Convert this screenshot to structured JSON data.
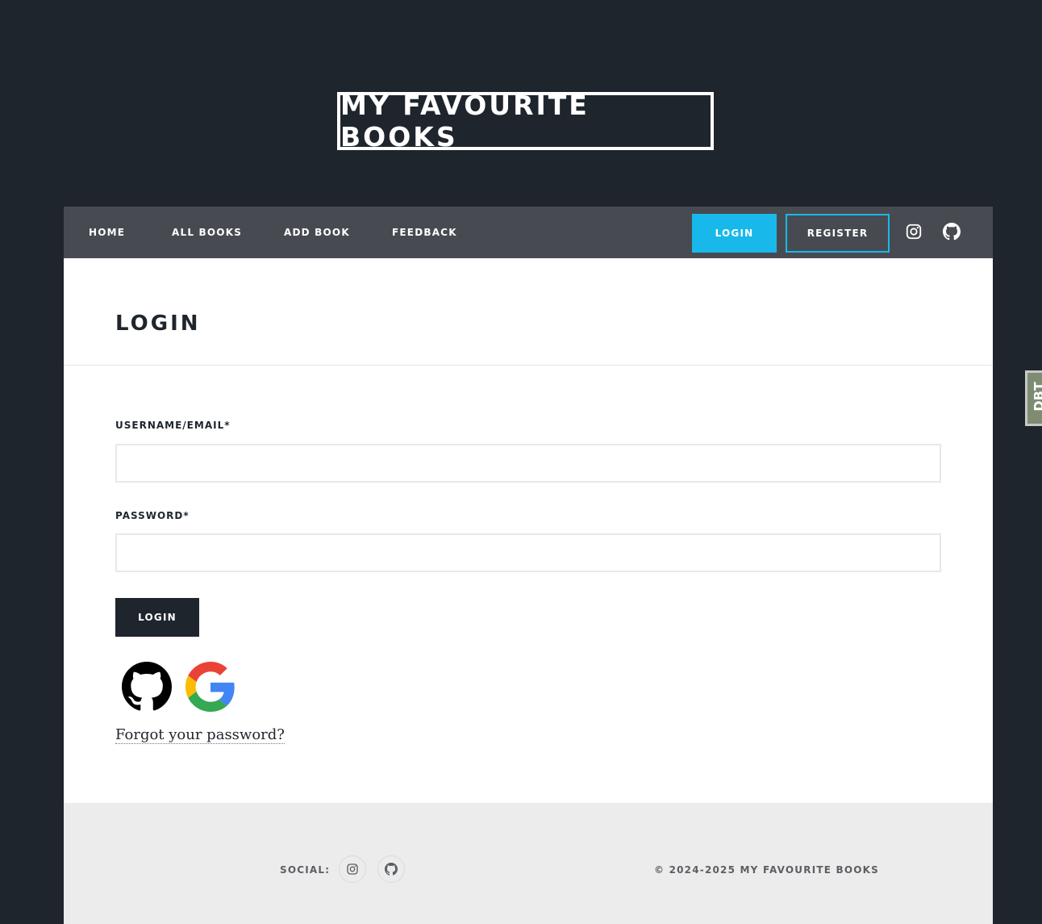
{
  "site": {
    "title": "MY FAVOURITE BOOKS"
  },
  "nav": {
    "links": [
      "HOME",
      "ALL BOOKS",
      "ADD BOOK",
      "FEEDBACK"
    ],
    "login_label": "LOGIN",
    "register_label": "REGISTER",
    "icons": [
      "instagram-icon",
      "github-icon"
    ]
  },
  "page": {
    "title": "LOGIN"
  },
  "form": {
    "username_label": "USERNAME/EMAIL*",
    "username_value": "",
    "password_label": "PASSWORD*",
    "password_value": "",
    "submit_label": "LOGIN",
    "oauth_icons": [
      "github-icon",
      "google-icon"
    ],
    "forgot_link": "Forgot your password?"
  },
  "footer": {
    "social_label": "SOCIAL:",
    "social_icons": [
      "instagram-icon",
      "github-icon"
    ],
    "copyright": "© 2024-2025 MY FAVOURITE BOOKS"
  },
  "side_tab": {
    "label": "DBT"
  },
  "colors": {
    "background": "#1f252d",
    "nav_bg": "#474b51",
    "accent": "#18b9ea",
    "footer_bg": "#ececec"
  }
}
